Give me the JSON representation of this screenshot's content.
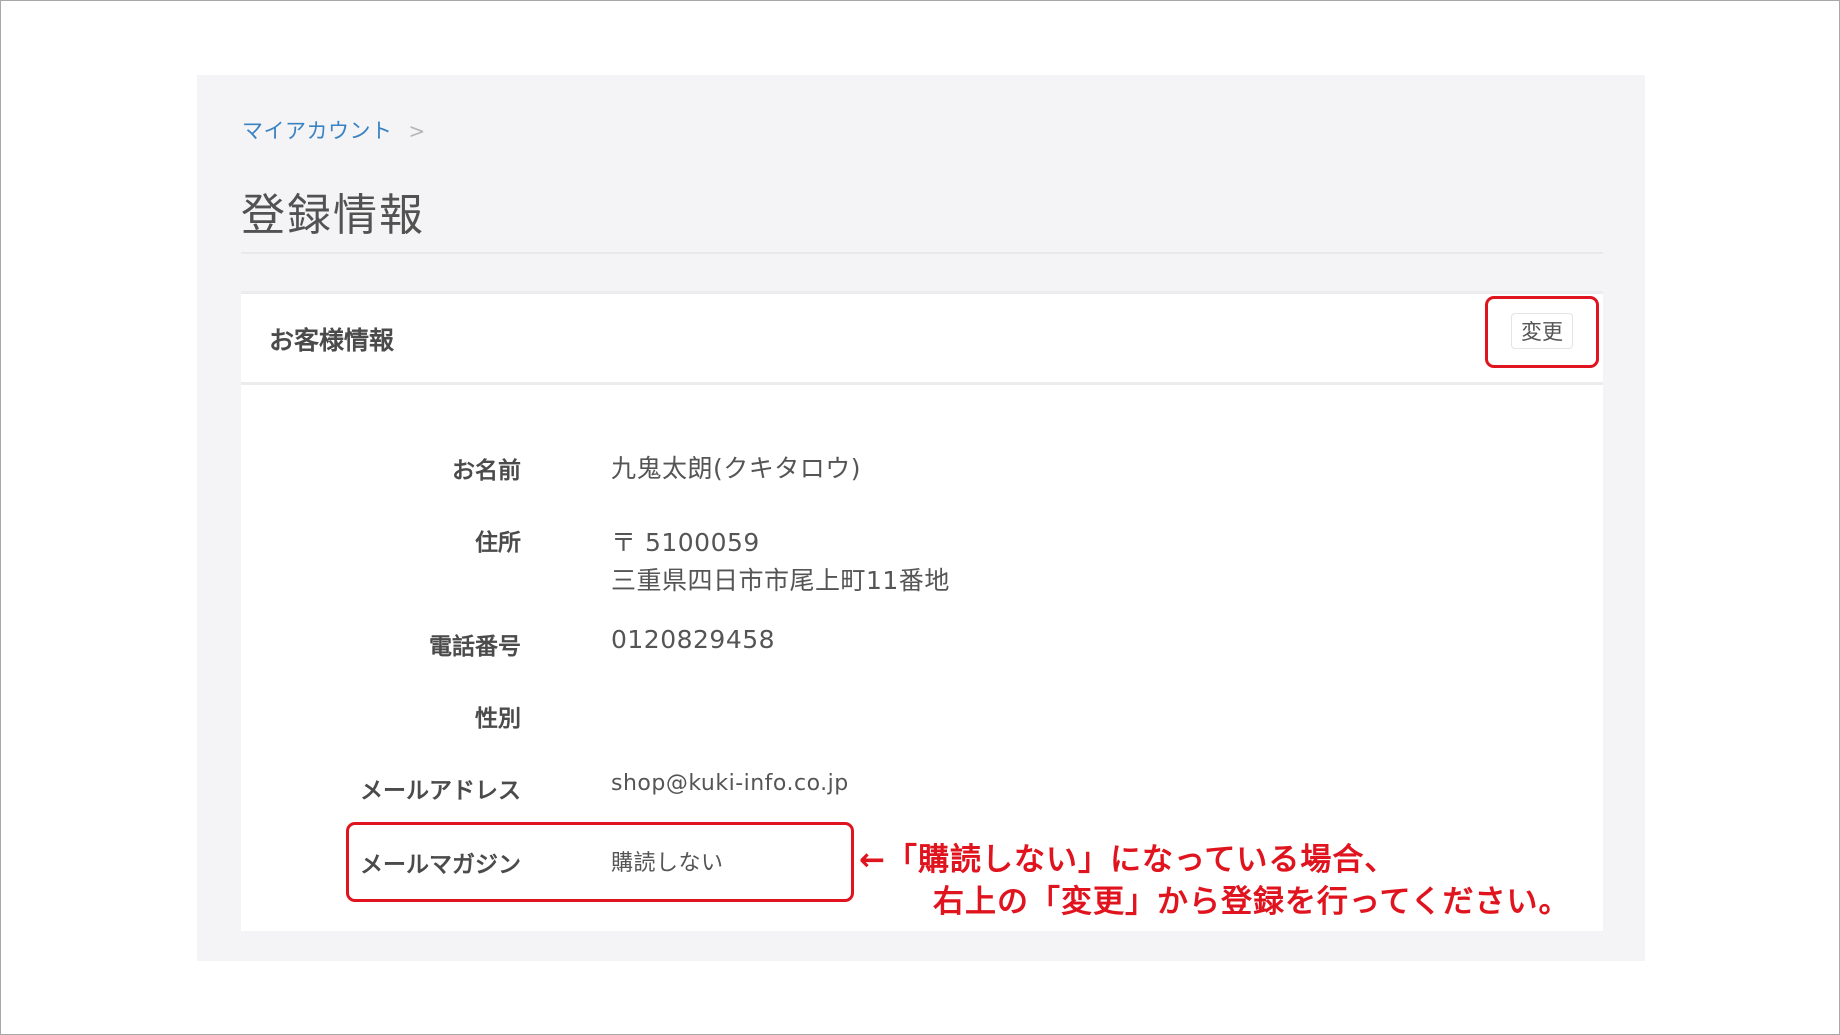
{
  "breadcrumb": {
    "link": "マイアカウント",
    "separator": ">"
  },
  "page_title": "登録情報",
  "card": {
    "title": "お客様情報",
    "edit_button": "変更"
  },
  "fields": {
    "name": {
      "label": "お名前",
      "value": "九鬼太朗(クキタロウ)"
    },
    "address": {
      "label": "住所",
      "postal": "〒 5100059",
      "line": "三重県四日市市尾上町11番地"
    },
    "phone": {
      "label": "電話番号",
      "value": "0120829458"
    },
    "gender": {
      "label": "性別",
      "value": ""
    },
    "email": {
      "label": "メールアドレス",
      "value": "shop@kuki-info.co.jp"
    },
    "magazine": {
      "label": "メールマガジン",
      "value": "購読しない"
    }
  },
  "annotation": {
    "line1": "←「購読しない」になっている場合、",
    "line2": "右上の「変更」から登録を行ってください。"
  },
  "colors": {
    "highlight": "#e0141e",
    "link": "#3a83c2"
  }
}
